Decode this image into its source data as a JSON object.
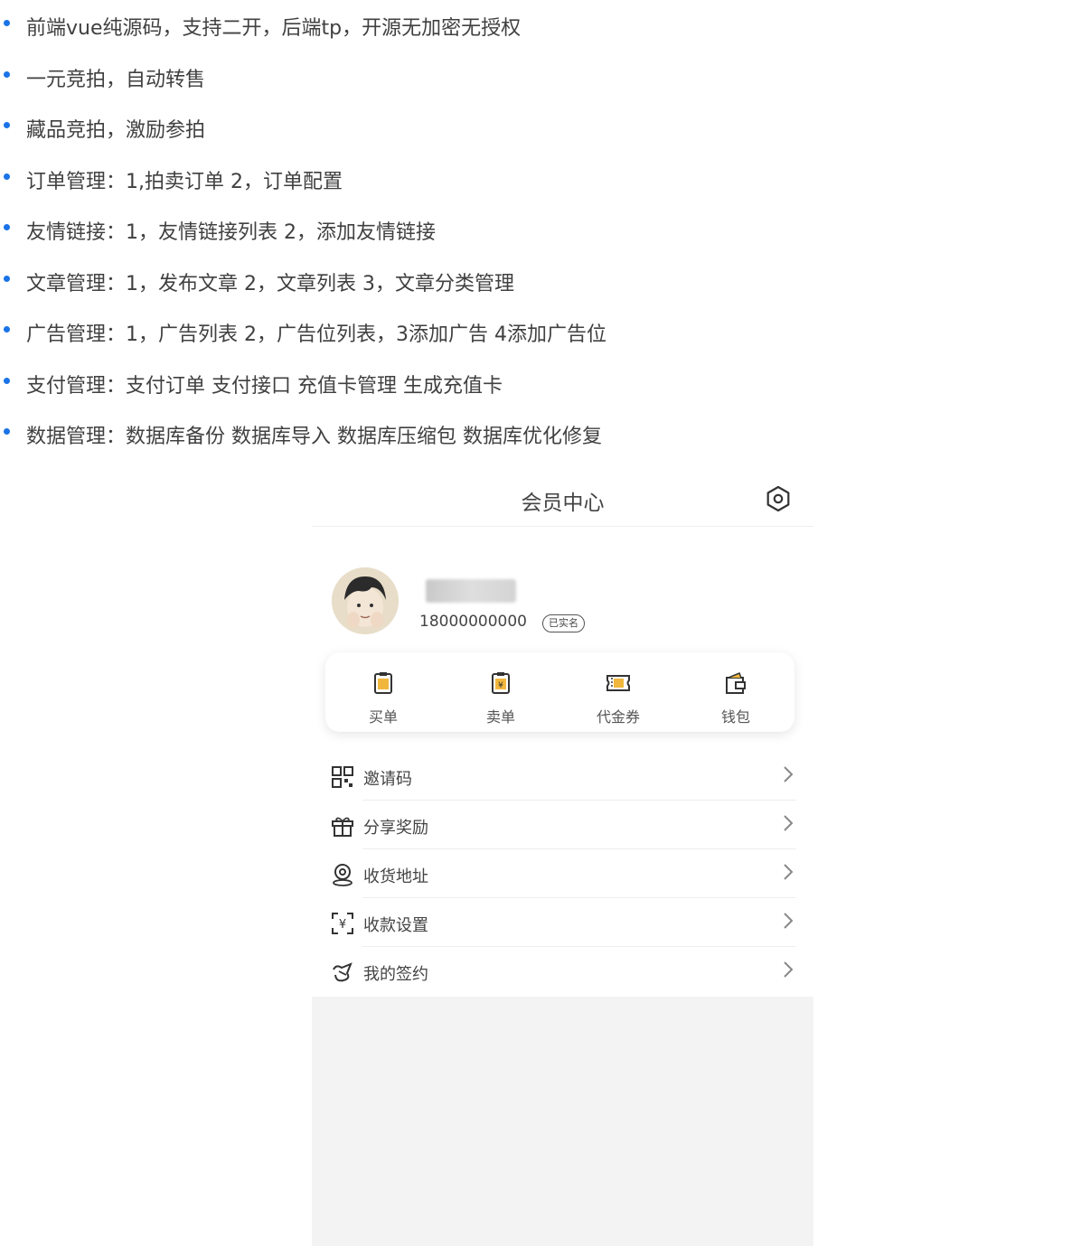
{
  "bullets": [
    "前端vue纯源码，支持二开，后端tp，开源无加密无授权",
    "一元竞拍，自动转售",
    "藏品竞拍，激励参拍",
    "订单管理：1,拍卖订单 2，订单配置",
    "友情链接：1，友情链接列表 2，添加友情链接",
    "文章管理：1，发布文章 2，文章列表 3，文章分类管理",
    "广告管理：1，广告列表 2，广告位列表，3添加广告 4添加广告位",
    "支付管理：支付订单 支付接口 充值卡管理 生成充值卡",
    "数据管理：数据库备份 数据库导入 数据库压缩包 数据库优化修复"
  ],
  "colors": {
    "bullet": "#1a73e8",
    "accent": "#e8a33a"
  },
  "phone": {
    "title": "会员中心",
    "settings_icon": "settings-icon",
    "profile": {
      "phone": "18000000000",
      "verified_badge": "已实名"
    },
    "quick_actions": [
      {
        "label": "买单",
        "icon": "buy-order-icon"
      },
      {
        "label": "卖单",
        "icon": "sell-order-icon"
      },
      {
        "label": "代金券",
        "icon": "coupon-icon"
      },
      {
        "label": "钱包",
        "icon": "wallet-icon"
      }
    ],
    "menu": [
      {
        "label": "邀请码",
        "icon": "qrcode-icon"
      },
      {
        "label": "分享奖励",
        "icon": "gift-icon"
      },
      {
        "label": "收货地址",
        "icon": "location-icon"
      },
      {
        "label": "收款设置",
        "icon": "payment-icon"
      },
      {
        "label": "我的签约",
        "icon": "sign-icon"
      }
    ]
  }
}
